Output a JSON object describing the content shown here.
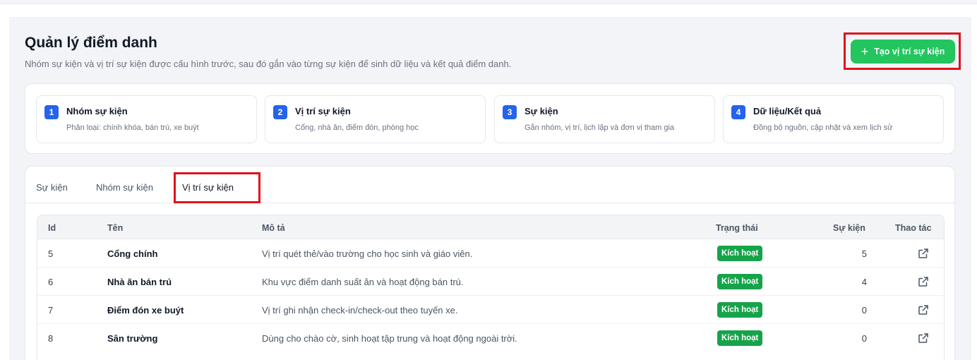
{
  "header": {
    "title": "Quản lý điểm danh",
    "subtitle": "Nhóm sự kiện và vị trí sự kiện được cấu hình trước, sau đó gắn vào từng sự kiện để sinh dữ liệu và kết quả điểm danh.",
    "create_button_label": "Tạo vị trí sự kiện",
    "create_button_icon": "plus-icon",
    "accent_color": "#22c55e"
  },
  "steps": [
    {
      "number": "1",
      "title": "Nhóm sự kiện",
      "desc": "Phân loại: chính khóa, bán trú, xe buýt"
    },
    {
      "number": "2",
      "title": "Vị trí sự kiện",
      "desc": "Cổng, nhà ăn, điểm đón, phòng học"
    },
    {
      "number": "3",
      "title": "Sự kiện",
      "desc": "Gắn nhóm, vị trí, lịch lặp và đơn vị tham gia"
    },
    {
      "number": "4",
      "title": "Dữ liệu/Kết quả",
      "desc": "Đồng bộ nguồn, cập nhật và xem lịch sử"
    }
  ],
  "tabs": [
    {
      "label": "Sự kiện",
      "active": false
    },
    {
      "label": "Nhóm sự kiện",
      "active": false
    },
    {
      "label": "Vị trí sự kiện",
      "active": true
    }
  ],
  "table": {
    "columns": [
      "Id",
      "Tên",
      "Mô tả",
      "Trạng thái",
      "Sự kiện",
      "Thao tác"
    ],
    "rows": [
      {
        "id": "5",
        "name": "Cổng chính",
        "desc": "Vị trí quét thẻ/vào trường cho học sinh và giáo viên.",
        "status": "Kích hoạt",
        "events": "5"
      },
      {
        "id": "6",
        "name": "Nhà ăn bán trú",
        "desc": "Khu vực điểm danh suất ăn và hoạt động bán trú.",
        "status": "Kích hoạt",
        "events": "4"
      },
      {
        "id": "7",
        "name": "Điểm đón xe buýt",
        "desc": "Vị trí ghi nhận check-in/check-out theo tuyến xe.",
        "status": "Kích hoạt",
        "events": "0"
      },
      {
        "id": "8",
        "name": "Sân trường",
        "desc": "Dùng cho chào cờ, sinh hoạt tập trung và hoạt động ngoài trời.",
        "status": "Kích hoạt",
        "events": "0"
      }
    ],
    "action_icon": "external-link-icon",
    "status_color": "#16a34a"
  }
}
